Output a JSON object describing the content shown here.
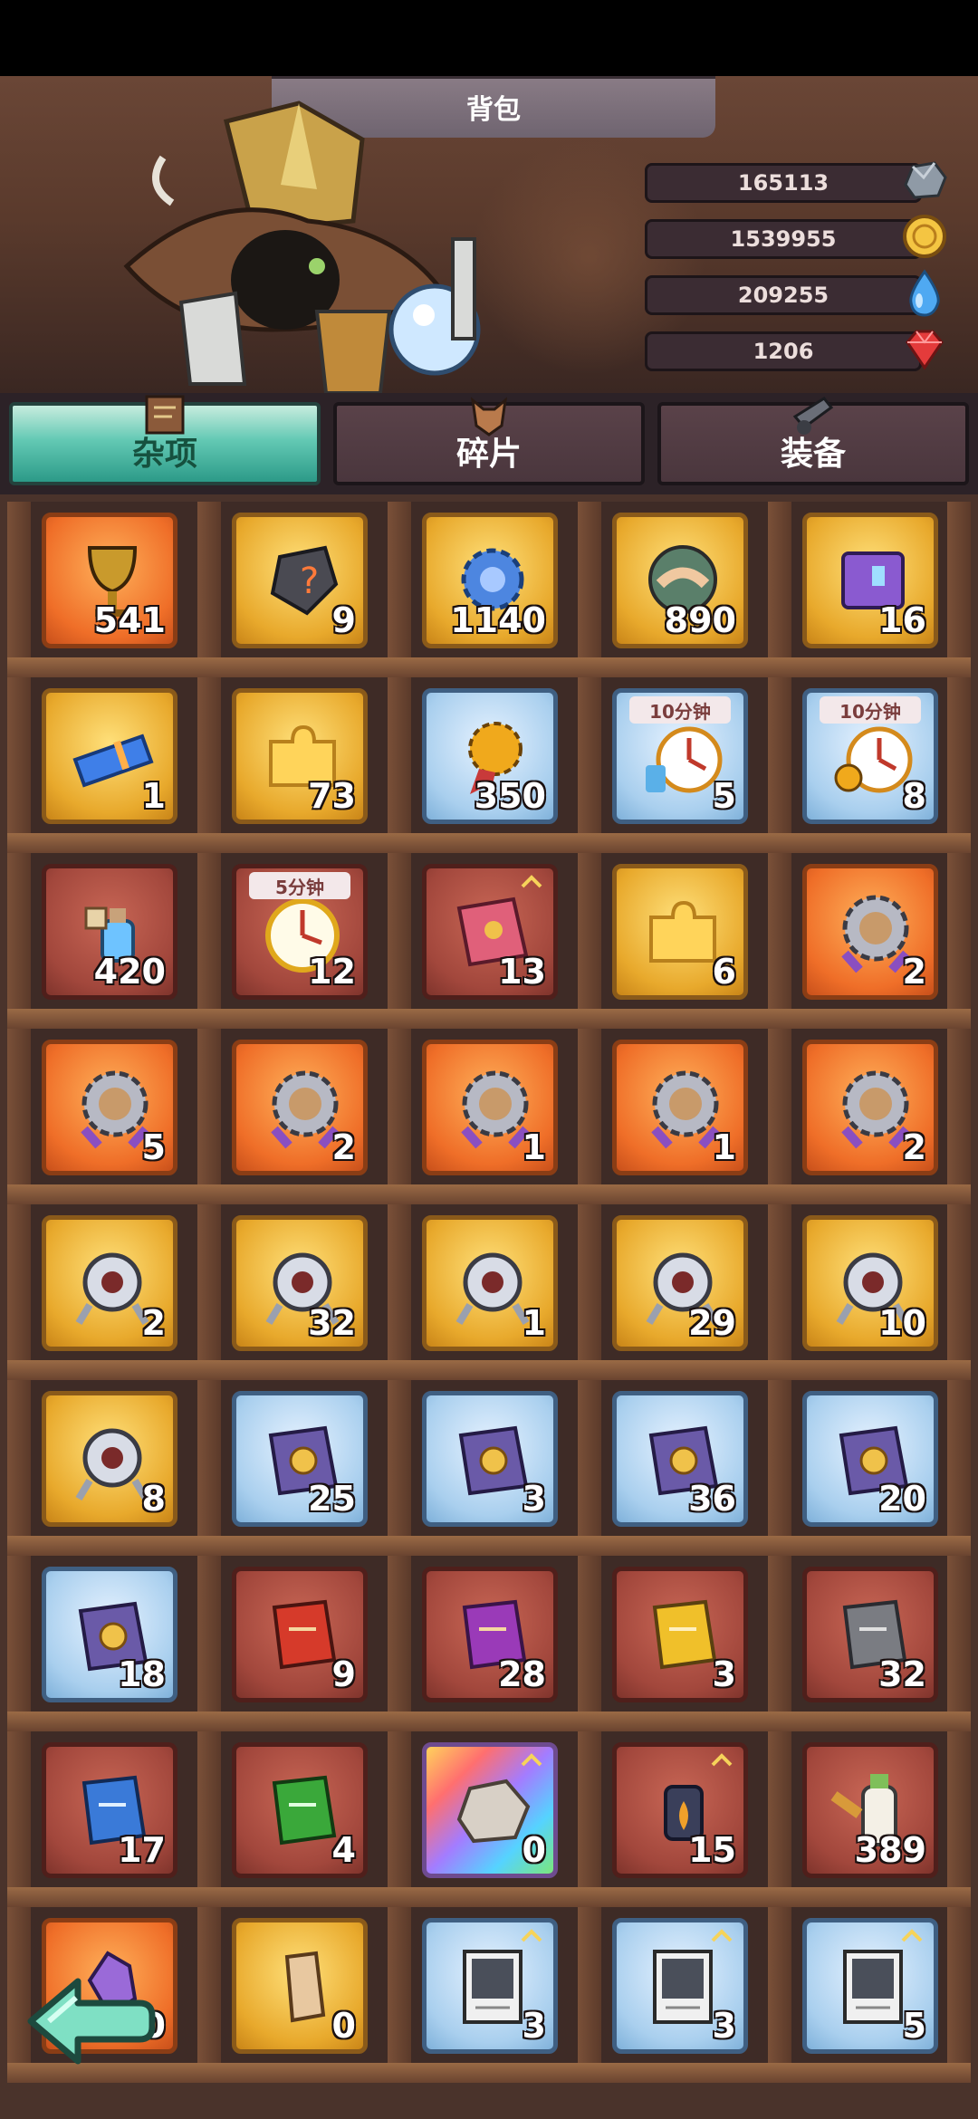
{
  "header": {
    "title": "背包"
  },
  "resources": [
    {
      "value": "165113",
      "icon": "stone-icon"
    },
    {
      "value": "1539955",
      "icon": "gold-coin-icon"
    },
    {
      "value": "209255",
      "icon": "water-drop-icon"
    },
    {
      "value": "1206",
      "icon": "red-gem-icon"
    }
  ],
  "tabs": [
    {
      "label": "杂项",
      "active": true
    },
    {
      "label": "碎片",
      "active": false
    },
    {
      "label": "装备",
      "active": false
    }
  ],
  "rows": [
    [
      {
        "count": "541",
        "bg": "orange",
        "icon": "chalice-icon"
      },
      {
        "count": "9",
        "bg": "gold",
        "icon": "mystery-stone-icon"
      },
      {
        "count": "1140",
        "bg": "gold",
        "icon": "blue-gear-icon"
      },
      {
        "count": "890",
        "bg": "gold",
        "icon": "handshake-emblem-icon"
      },
      {
        "count": "16",
        "bg": "gold",
        "icon": "purple-book-icon"
      }
    ],
    [
      {
        "count": "1",
        "bg": "gold",
        "icon": "blue-ticket-icon"
      },
      {
        "count": "73",
        "bg": "gold",
        "icon": "puzzle-piece-icon"
      },
      {
        "count": "350",
        "bg": "blue",
        "icon": "gear-medal-icon"
      },
      {
        "count": "5",
        "bg": "blue",
        "icon": "clock-potion-icon",
        "timer": "10分钟"
      },
      {
        "count": "8",
        "bg": "blue",
        "icon": "clock-gear-icon",
        "timer": "10分钟"
      }
    ],
    [
      {
        "count": "420",
        "bg": "red",
        "icon": "potion-tag-icon"
      },
      {
        "count": "12",
        "bg": "red",
        "icon": "clock-icon",
        "timer": "5分钟"
      },
      {
        "count": "13",
        "bg": "red",
        "icon": "pink-book-icon",
        "chev": true
      },
      {
        "count": "6",
        "bg": "gold",
        "icon": "puzzle-piece-icon"
      },
      {
        "count": "2",
        "bg": "orange",
        "icon": "gear-badge-icon"
      }
    ],
    [
      {
        "count": "5",
        "bg": "orange",
        "icon": "gear-badge-icon"
      },
      {
        "count": "2",
        "bg": "orange",
        "icon": "gear-badge-icon"
      },
      {
        "count": "1",
        "bg": "orange",
        "icon": "gear-badge-icon"
      },
      {
        "count": "1",
        "bg": "orange",
        "icon": "gear-badge-icon"
      },
      {
        "count": "2",
        "bg": "orange",
        "icon": "gear-badge-icon"
      }
    ],
    [
      {
        "count": "2",
        "bg": "gold",
        "icon": "eye-charm-icon"
      },
      {
        "count": "32",
        "bg": "gold",
        "icon": "eye-charm-icon"
      },
      {
        "count": "1",
        "bg": "gold",
        "icon": "eye-charm-icon"
      },
      {
        "count": "29",
        "bg": "gold",
        "icon": "eye-charm-icon"
      },
      {
        "count": "10",
        "bg": "gold",
        "icon": "eye-charm-icon"
      }
    ],
    [
      {
        "count": "8",
        "bg": "gold",
        "icon": "eye-charm-icon"
      },
      {
        "count": "25",
        "bg": "blue",
        "icon": "spellbook-icon"
      },
      {
        "count": "3",
        "bg": "blue",
        "icon": "spellbook-icon"
      },
      {
        "count": "36",
        "bg": "blue",
        "icon": "spellbook-icon"
      },
      {
        "count": "20",
        "bg": "blue",
        "icon": "spellbook-icon"
      }
    ],
    [
      {
        "count": "18",
        "bg": "blue",
        "icon": "spellbook-icon"
      },
      {
        "count": "9",
        "bg": "red",
        "icon": "red-tome-icon"
      },
      {
        "count": "28",
        "bg": "red",
        "icon": "purple-tome-icon"
      },
      {
        "count": "3",
        "bg": "red",
        "icon": "yellow-tome-icon"
      },
      {
        "count": "32",
        "bg": "red",
        "icon": "gray-tome-icon"
      }
    ],
    [
      {
        "count": "17",
        "bg": "red",
        "icon": "blue-tome-icon"
      },
      {
        "count": "4",
        "bg": "red",
        "icon": "green-tome-icon"
      },
      {
        "count": "0",
        "bg": "rainbow",
        "icon": "rock-icon",
        "chev": true
      },
      {
        "count": "15",
        "bg": "red",
        "icon": "lantern-icon",
        "chev": true
      },
      {
        "count": "389",
        "bg": "red",
        "icon": "milk-bottle-icon"
      }
    ],
    [
      {
        "count": "0",
        "bg": "orange",
        "icon": "crystal-icon"
      },
      {
        "count": "0",
        "bg": "gold",
        "icon": "horn-fragment-icon"
      },
      {
        "count": "3",
        "bg": "blue",
        "icon": "photo-card-icon",
        "chev": true
      },
      {
        "count": "3",
        "bg": "blue",
        "icon": "photo-card-icon",
        "chev": true
      },
      {
        "count": "5",
        "bg": "blue",
        "icon": "photo-card-icon",
        "chev": true
      }
    ]
  ]
}
